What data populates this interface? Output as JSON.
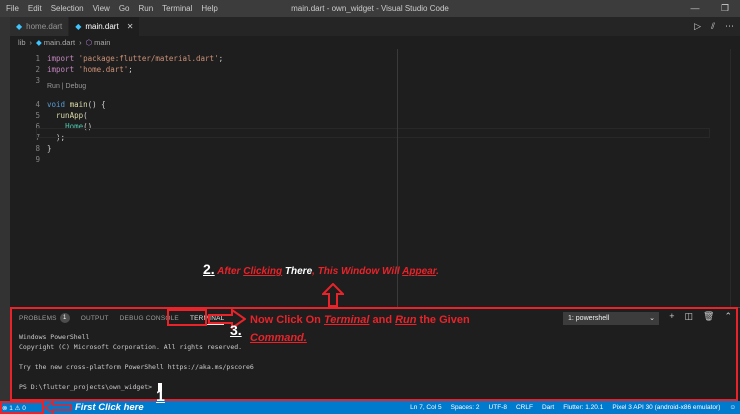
{
  "window": {
    "menu": [
      "File",
      "Edit",
      "Selection",
      "View",
      "Go",
      "Run",
      "Terminal",
      "Help"
    ],
    "title": "main.dart - own_widget - Visual Studio Code",
    "controls": [
      "—",
      "❐"
    ]
  },
  "tabs": [
    {
      "label": "home.dart",
      "active": false
    },
    {
      "label": "main.dart",
      "active": true,
      "close": "✕"
    }
  ],
  "editor_actions": [
    "▷",
    "⫽",
    "⋯"
  ],
  "breadcrumb": [
    "lib",
    "main.dart",
    "main"
  ],
  "code": {
    "lines": [
      {
        "n": "1",
        "tokens": [
          [
            "kw",
            "import"
          ],
          [
            "",
            " "
          ],
          [
            "str",
            "'package:flutter/material.dart'"
          ],
          [
            "",
            ";"
          ]
        ]
      },
      {
        "n": "2",
        "tokens": [
          [
            "kw",
            "import"
          ],
          [
            "",
            " "
          ],
          [
            "str",
            "'home.dart'"
          ],
          [
            "",
            ";"
          ]
        ]
      },
      {
        "n": "3",
        "tokens": []
      },
      {
        "n": "4",
        "tokens": [
          [
            "kw2",
            "void"
          ],
          [
            "",
            " "
          ],
          [
            "fn",
            "main"
          ],
          [
            "",
            "() {"
          ]
        ]
      },
      {
        "n": "5",
        "tokens": [
          [
            "",
            "  "
          ],
          [
            "fn",
            "runApp"
          ],
          [
            "",
            "("
          ]
        ]
      },
      {
        "n": "6",
        "tokens": [
          [
            "",
            "    "
          ],
          [
            "cls",
            "Home"
          ],
          [
            "",
            "()"
          ]
        ]
      },
      {
        "n": "7",
        "tokens": [
          [
            "",
            "  );"
          ]
        ]
      },
      {
        "n": "8",
        "tokens": [
          [
            "",
            "}"
          ]
        ]
      },
      {
        "n": "9",
        "tokens": []
      }
    ],
    "codelens": "Run | Debug"
  },
  "annotation2": {
    "num": "2.",
    "p1": " After ",
    "p2": "Clicking",
    "p3": " There",
    "p4": ", This ",
    "p5": "Window",
    "p6": " Will ",
    "p7": "Appear",
    "p8": "."
  },
  "panel": {
    "tabs": [
      {
        "label": "PROBLEMS",
        "badge": "1"
      },
      {
        "label": "OUTPUT"
      },
      {
        "label": "DEBUG CONSOLE"
      },
      {
        "label": "TERMINAL",
        "active": true
      }
    ],
    "shell": "1: powershell",
    "actions": [
      "+",
      "◫",
      "🗑",
      "⌃"
    ],
    "terminal_lines": [
      "Windows PowerShell",
      "Copyright (C) Microsoft Corporation. All rights reserved.",
      "",
      "Try the new cross-platform PowerShell https://aka.ms/pscore6",
      "",
      "PS D:\\flutter_projects\\own_widget> "
    ]
  },
  "annotation3": {
    "num": "3.",
    "p1": "Now Click On ",
    "p2": "Terminal",
    "p3": " and ",
    "p4": "Run",
    "p5": " the Given",
    "p6": "Command."
  },
  "status": {
    "left": "⊗ 1 ⚠ 0",
    "right": [
      "Ln 7, Col 5",
      "Spaces: 2",
      "UTF-8",
      "CRLF",
      "Dart",
      "Flutter: 1.20.1",
      "Pixel 3 API 30 (android-x86 emulator)",
      "☺"
    ]
  },
  "annotation1": {
    "text": "First Click here",
    "num": "1"
  },
  "colors": {
    "accent_red": "#e8232a",
    "status_blue": "#007acc"
  }
}
